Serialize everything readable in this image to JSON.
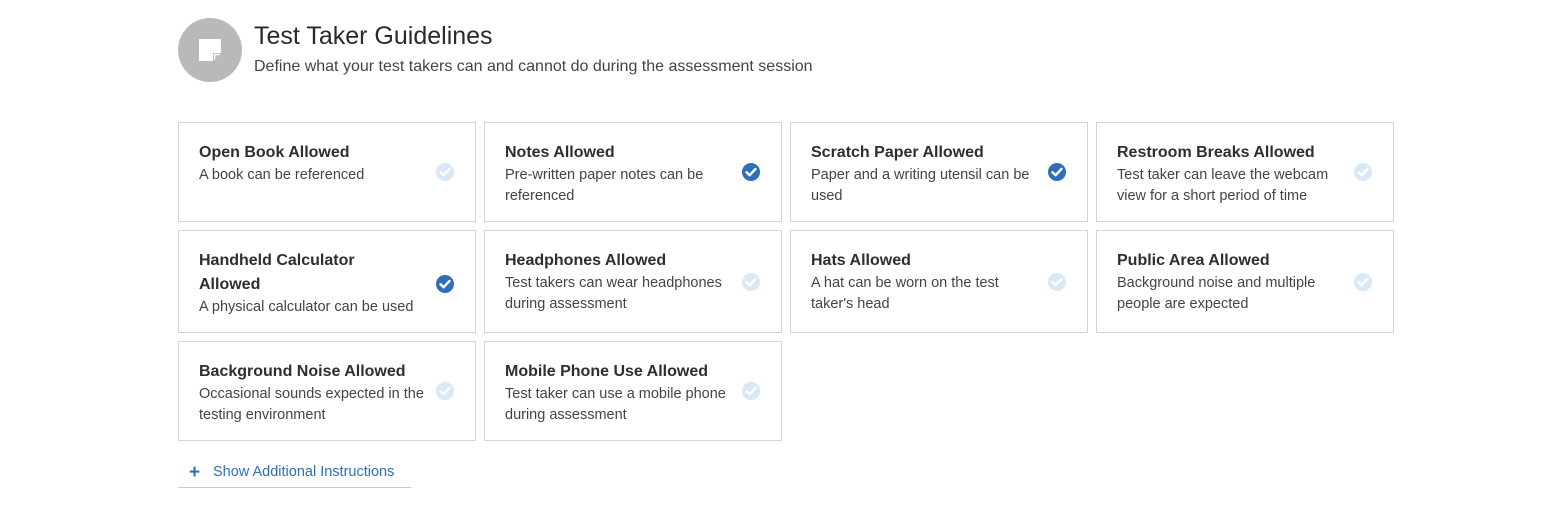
{
  "header": {
    "title": "Test Taker Guidelines",
    "subtitle": "Define what your test takers can and cannot do during the assessment session",
    "icon": "sticky-note-icon"
  },
  "colors": {
    "checked": "#2f6fb8",
    "unchecked": "#d9e8f7",
    "icon_bg": "#b9b9b9",
    "link": "#2f6fb8"
  },
  "guidelines": [
    {
      "title": "Open Book Allowed",
      "description": "A book can be referenced",
      "checked": false
    },
    {
      "title": "Notes Allowed",
      "description": "Pre-written paper notes can be referenced",
      "checked": true
    },
    {
      "title": "Scratch Paper Allowed",
      "description": "Paper and a writing utensil can be used",
      "checked": true
    },
    {
      "title": "Restroom Breaks Allowed",
      "description": "Test taker can leave the webcam view for a short period of time",
      "checked": false
    },
    {
      "title": "Handheld Calculator Allowed",
      "description": "A physical calculator can be used",
      "checked": true
    },
    {
      "title": "Headphones Allowed",
      "description": "Test takers can wear headphones during assessment",
      "checked": false
    },
    {
      "title": "Hats Allowed",
      "description": "A hat can be worn on the test taker's head",
      "checked": false
    },
    {
      "title": "Public Area Allowed",
      "description": "Background noise and multiple people are expected",
      "checked": false
    },
    {
      "title": "Background Noise Allowed",
      "description": "Occasional sounds expected in the testing environment",
      "checked": false
    },
    {
      "title": "Mobile Phone Use Allowed",
      "description": "Test taker can use a mobile phone during assessment",
      "checked": false
    }
  ],
  "additional_instructions": {
    "label": "Show Additional Instructions",
    "icon": "plus-icon"
  }
}
